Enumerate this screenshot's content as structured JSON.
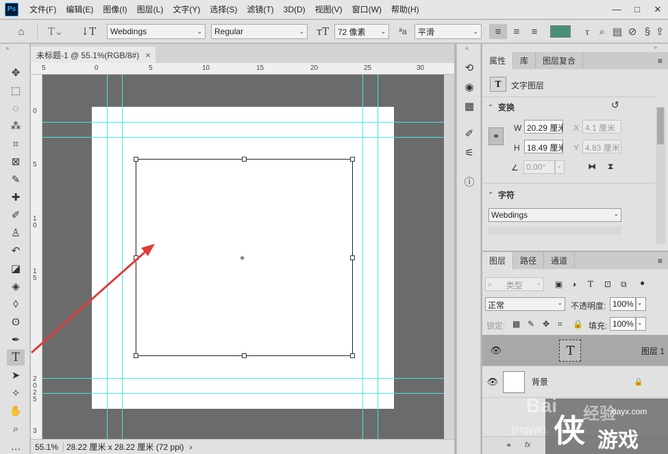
{
  "menubar": {
    "logo": "Ps",
    "items": [
      "文件(F)",
      "编辑(E)",
      "图像(I)",
      "图层(L)",
      "文字(Y)",
      "选择(S)",
      "滤镜(T)",
      "3D(D)",
      "视图(V)",
      "窗口(W)",
      "帮助(H)"
    ],
    "window_buttons": [
      "—",
      "□",
      "✕"
    ]
  },
  "options": {
    "font_family": "Webdings",
    "font_style": "Regular",
    "font_size": "72 像素",
    "aa_label": "ªa",
    "anti_alias": "平滑",
    "color_swatch": "#4a8f7c"
  },
  "document": {
    "tab_title": "未标题-1 @ 55.1%(RGB/8#)",
    "tab_close": "×",
    "zoom": "55.1%",
    "doc_size": "28.22 厘米 x 28.22 厘米 (72 ppi)",
    "status_arrow": "›"
  },
  "rulers": {
    "top": [
      "5",
      "0",
      "5",
      "10",
      "15",
      "20",
      "25",
      "30"
    ],
    "left": [
      "0",
      "5",
      "1",
      "0",
      "1",
      "5",
      "2",
      "0",
      "2",
      "5",
      "3"
    ]
  },
  "properties": {
    "tabs": [
      "属性",
      "库",
      "图层复合"
    ],
    "layer_type": "文字图层",
    "transform_title": "变换",
    "w_label": "W",
    "w_value": "20.29 厘米",
    "h_label": "H",
    "h_value": "18.49 厘米",
    "x_label": "X",
    "x_value": "4.1 厘米",
    "y_label": "Y",
    "y_value": "4.83 厘米",
    "angle_value": "0.00°",
    "char_title": "字符",
    "char_font": "Webdings"
  },
  "layers": {
    "tabs": [
      "图层",
      "路径",
      "通道"
    ],
    "filter_placeholder": "类型",
    "blend_mode": "正常",
    "opacity_label": "不透明度:",
    "opacity": "100%",
    "lock_label": "锁定:",
    "fill_label": "填充:",
    "fill": "100%",
    "items": [
      {
        "name": "图层 1",
        "thumb": "T",
        "selected": true
      },
      {
        "name": "背景",
        "thumb": "",
        "selected": false
      }
    ]
  },
  "watermark": {
    "brand": "Bai",
    "jingyan": "经验",
    "site": "xiayx.com",
    "url": "jingyan.",
    "game_text": "游戏"
  }
}
